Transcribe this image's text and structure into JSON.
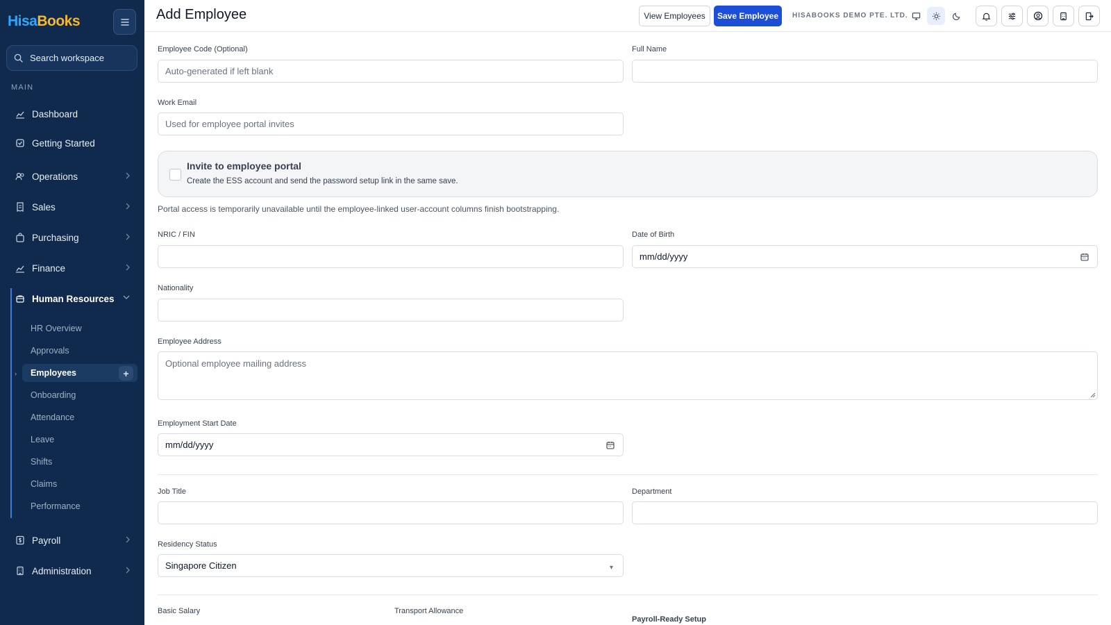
{
  "brand": {
    "part1": "Hisa",
    "part2": "Books"
  },
  "search": {
    "label": "Search workspace"
  },
  "sidebar": {
    "section": "MAIN",
    "items": [
      {
        "label": "Dashboard"
      },
      {
        "label": "Getting Started"
      },
      {
        "label": "Operations"
      },
      {
        "label": "Sales"
      },
      {
        "label": "Purchasing"
      },
      {
        "label": "Finance"
      },
      {
        "label": "Human Resources"
      },
      {
        "label": "Payroll"
      },
      {
        "label": "Administration"
      }
    ],
    "hr_sub": [
      {
        "label": "HR Overview"
      },
      {
        "label": "Approvals"
      },
      {
        "label": "Employees"
      },
      {
        "label": "Onboarding"
      },
      {
        "label": "Attendance"
      },
      {
        "label": "Leave"
      },
      {
        "label": "Shifts"
      },
      {
        "label": "Claims"
      },
      {
        "label": "Performance"
      }
    ],
    "add_icon": "+"
  },
  "header": {
    "title": "Add Employee",
    "view_employees": "View Employees",
    "save_employee": "Save Employee",
    "company": "HISABOOKS DEMO PTE. LTD."
  },
  "form": {
    "employee_code": {
      "label": "Employee Code (Optional)",
      "placeholder": "Auto-generated if left blank"
    },
    "full_name": {
      "label": "Full Name",
      "placeholder": ""
    },
    "work_email": {
      "label": "Work Email",
      "placeholder": "Used for employee portal invites"
    },
    "portal": {
      "title": "Invite to employee portal",
      "desc": "Create the ESS account and send the password setup link in the same save.",
      "note": "Portal access is temporarily unavailable until the employee-linked user-account columns finish bootstrapping."
    },
    "nric": {
      "label": "NRIC / FIN"
    },
    "dob": {
      "label": "Date of Birth",
      "value": "mm/dd/yyyy"
    },
    "nationality": {
      "label": "Nationality"
    },
    "address": {
      "label": "Employee Address",
      "placeholder": "Optional employee mailing address"
    },
    "start_date": {
      "label": "Employment Start Date",
      "value": "mm/dd/yyyy"
    },
    "job_title": {
      "label": "Job Title"
    },
    "department": {
      "label": "Department"
    },
    "residency": {
      "label": "Residency Status",
      "value": "Singapore Citizen"
    },
    "basic_salary": {
      "label": "Basic Salary"
    },
    "transport": {
      "label": "Transport Allowance"
    },
    "payroll_ready": {
      "label": "Payroll-Ready Setup"
    }
  },
  "icons": {
    "search": "search-icon",
    "menu": "menu-icon",
    "monitor": "monitor-icon",
    "sun": "sun-icon",
    "moon": "moon-icon",
    "bell": "bell-icon",
    "sliders": "sliders-icon",
    "user": "user-circle-icon",
    "building": "building-icon",
    "logout": "logout-icon",
    "calendar": "calendar-icon"
  },
  "colors": {
    "sidebar": "#0f2a4d",
    "primary": "#1d4ed8",
    "brand_blue": "#2ea8ff",
    "brand_gold": "#f5b82e"
  }
}
